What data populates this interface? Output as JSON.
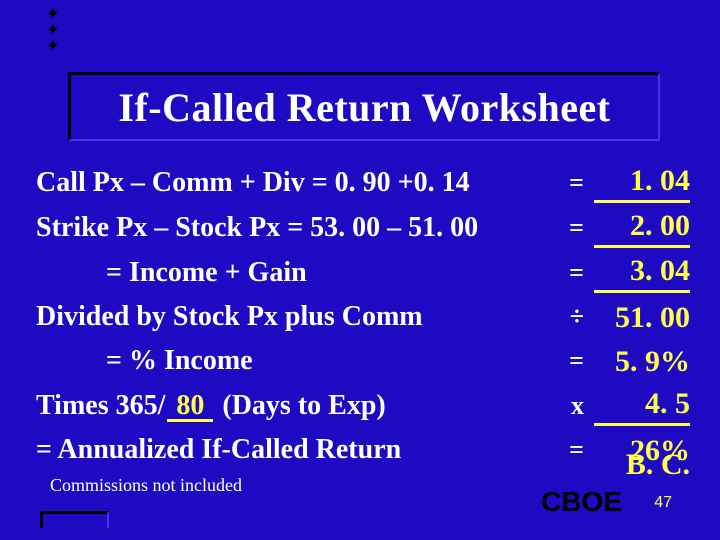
{
  "title": "If-Called Return Worksheet",
  "rows": [
    {
      "label": "Call Px – Comm + Div = 0. 90 +0. 14",
      "indent": false,
      "sym": "=",
      "val": "1. 04",
      "underline": true
    },
    {
      "label": "Strike Px – Stock Px = 53. 00 – 51. 00",
      "indent": false,
      "sym": "=",
      "val": "2. 00",
      "underline": true
    },
    {
      "label": "= Income + Gain",
      "indent": true,
      "sym": "=",
      "val": "3. 04",
      "underline": true
    },
    {
      "label": "Divided by Stock Px plus Comm",
      "indent": false,
      "sym": "÷",
      "val": "51. 00",
      "underline": false
    },
    {
      "label": "= % Income",
      "indent": true,
      "sym": "=",
      "val": "5. 9%",
      "underline": false
    },
    {
      "label_pre": "Times 365/",
      "blank": "80",
      "label_post": " (Days to Exp)",
      "indent": false,
      "sym": "x",
      "val": "4. 5",
      "underline": true
    },
    {
      "label": "= Annualized If-Called Return",
      "indent": false,
      "sym": "=",
      "val": "26%",
      "underline": false
    }
  ],
  "bc": "B. C.",
  "footnote": "Commissions not included",
  "brand": "CBOE",
  "page": "47"
}
